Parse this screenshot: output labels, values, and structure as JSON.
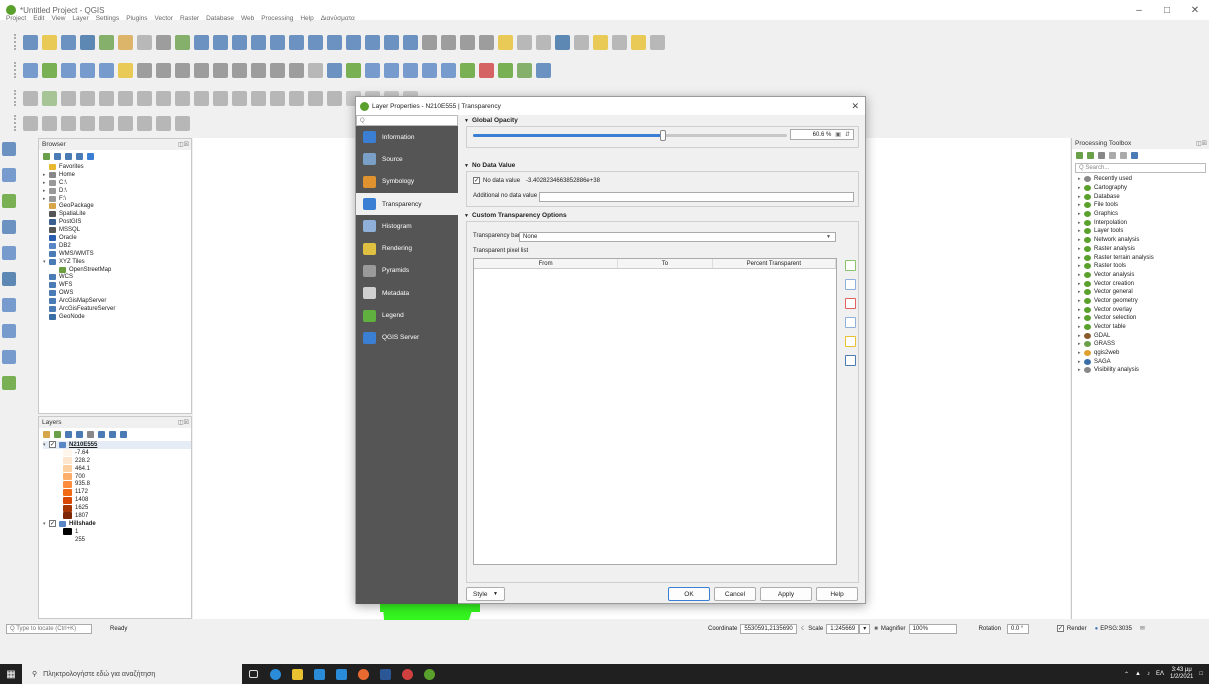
{
  "window": {
    "title": "*Untitled Project - QGIS",
    "min": "–",
    "max": "□",
    "close": "✕"
  },
  "menu": [
    "Project",
    "Edit",
    "View",
    "Layer",
    "Settings",
    "Plugins",
    "Vector",
    "Raster",
    "Database",
    "Web",
    "Processing",
    "Help",
    "Διανύσματα"
  ],
  "browser": {
    "title": "Browser",
    "items": [
      {
        "label": "Favorites",
        "color": "#e8b830",
        "arrow": ""
      },
      {
        "label": "Home",
        "color": "#888",
        "arrow": "▸"
      },
      {
        "label": "C:\\",
        "color": "#999",
        "arrow": "▸"
      },
      {
        "label": "D:\\",
        "color": "#999",
        "arrow": "▸"
      },
      {
        "label": "F:\\",
        "color": "#999",
        "arrow": "▸"
      },
      {
        "label": "GeoPackage",
        "color": "#d7a64a",
        "arrow": ""
      },
      {
        "label": "SpatiaLite",
        "color": "#555",
        "arrow": ""
      },
      {
        "label": "PostGIS",
        "color": "#3a5f8f",
        "arrow": ""
      },
      {
        "label": "MSSQL",
        "color": "#555",
        "arrow": ""
      },
      {
        "label": "Oracle",
        "color": "#2a5db0",
        "arrow": ""
      },
      {
        "label": "DB2",
        "color": "#5a86c5",
        "arrow": ""
      },
      {
        "label": "WMS/WMTS",
        "color": "#4b7bb5",
        "arrow": ""
      },
      {
        "label": "XYZ Tiles",
        "color": "#4b7bb5",
        "arrow": "▾"
      },
      {
        "label": "OpenStreetMap",
        "color": "#6a9e3f",
        "arrow": "",
        "indent": true
      },
      {
        "label": "WCS",
        "color": "#4b7bb5",
        "arrow": ""
      },
      {
        "label": "WFS",
        "color": "#4b7bb5",
        "arrow": ""
      },
      {
        "label": "OWS",
        "color": "#4b7bb5",
        "arrow": ""
      },
      {
        "label": "ArcGisMapServer",
        "color": "#4b7bb5",
        "arrow": ""
      },
      {
        "label": "ArcGisFeatureServer",
        "color": "#4b7bb5",
        "arrow": ""
      },
      {
        "label": "GeoNode",
        "color": "#3a6ea5",
        "arrow": ""
      }
    ]
  },
  "layers": {
    "title": "Layers",
    "layer1": "N210E555",
    "legend": [
      {
        "label": "-7.64",
        "color": "#fff5eb"
      },
      {
        "label": "228.2",
        "color": "#fee6ce"
      },
      {
        "label": "464.1",
        "color": "#fdd0a2"
      },
      {
        "label": "700",
        "color": "#fdae6b"
      },
      {
        "label": "935.8",
        "color": "#fd8d3c"
      },
      {
        "label": "1172",
        "color": "#f16913"
      },
      {
        "label": "1408",
        "color": "#d94801"
      },
      {
        "label": "1625",
        "color": "#a63603"
      },
      {
        "label": "1807",
        "color": "#7f2704"
      }
    ],
    "layer2": "Hillshade",
    "hs": [
      {
        "label": "1",
        "color": "#000"
      },
      {
        "label": "255",
        "color": "#fff"
      }
    ]
  },
  "dialog": {
    "title": "Layer Properties - N210E555 | Transparency",
    "search_placeholder": "Q",
    "nav": [
      {
        "label": "Information",
        "color": "#3b7fd4"
      },
      {
        "label": "Source",
        "color": "#7aa0c8"
      },
      {
        "label": "Symbology",
        "color": "#e0922f"
      },
      {
        "label": "Transparency",
        "color": "#3b7fd4"
      },
      {
        "label": "Histogram",
        "color": "#8fb0d8"
      },
      {
        "label": "Rendering",
        "color": "#e0c040"
      },
      {
        "label": "Pyramids",
        "color": "#9a9a9a"
      },
      {
        "label": "Metadata",
        "color": "#d0d0d0"
      },
      {
        "label": "Legend",
        "color": "#60b040"
      },
      {
        "label": "QGIS Server",
        "color": "#3b7fd4"
      }
    ],
    "global_opacity": {
      "label": "Global Opacity",
      "value": "60.6 %",
      "fraction": 0.606
    },
    "no_data": {
      "label": "No Data Value",
      "checkbox_label": "No data value",
      "value": "-3.4028234663852886e+38",
      "additional_label": "Additional no data value"
    },
    "custom": {
      "label": "Custom Transparency Options",
      "band_label": "Transparency band",
      "band_value": "None",
      "list_label": "Transparent pixel list",
      "cols": [
        "From",
        "To",
        "Percent Transparent"
      ]
    },
    "buttons": {
      "style": "Style",
      "ok": "OK",
      "cancel": "Cancel",
      "apply": "Apply",
      "help": "Help"
    }
  },
  "processing": {
    "title": "Processing Toolbox",
    "search_placeholder": "Q  Search...",
    "items": [
      {
        "label": "Recently used",
        "color": "#888"
      },
      {
        "label": "Cartography",
        "color": "#5aa02c"
      },
      {
        "label": "Database",
        "color": "#5aa02c"
      },
      {
        "label": "File tools",
        "color": "#5aa02c"
      },
      {
        "label": "Graphics",
        "color": "#5aa02c"
      },
      {
        "label": "Interpolation",
        "color": "#5aa02c"
      },
      {
        "label": "Layer tools",
        "color": "#5aa02c"
      },
      {
        "label": "Network analysis",
        "color": "#5aa02c"
      },
      {
        "label": "Raster analysis",
        "color": "#5aa02c"
      },
      {
        "label": "Raster terrain analysis",
        "color": "#5aa02c"
      },
      {
        "label": "Raster tools",
        "color": "#5aa02c"
      },
      {
        "label": "Vector analysis",
        "color": "#5aa02c"
      },
      {
        "label": "Vector creation",
        "color": "#5aa02c"
      },
      {
        "label": "Vector general",
        "color": "#5aa02c"
      },
      {
        "label": "Vector geometry",
        "color": "#5aa02c"
      },
      {
        "label": "Vector overlay",
        "color": "#5aa02c"
      },
      {
        "label": "Vector selection",
        "color": "#5aa02c"
      },
      {
        "label": "Vector table",
        "color": "#5aa02c"
      },
      {
        "label": "GDAL",
        "color": "#8a5a2a"
      },
      {
        "label": "GRASS",
        "color": "#6aa04a"
      },
      {
        "label": "qgis2web",
        "color": "#e0a030"
      },
      {
        "label": "SAGA",
        "color": "#3a6ea5"
      },
      {
        "label": "Visibility analysis",
        "color": "#888"
      }
    ]
  },
  "statusbar": {
    "locate_placeholder": "Q  Type to locate (Ctrl+K)",
    "ready": "Ready",
    "coordinate_label": "Coordinate",
    "coordinate_value": "5530591,2135690",
    "scale_label": "Scale",
    "scale_value": "1:245669",
    "magnifier_label": "Magnifier",
    "magnifier_value": "100%",
    "rotation_label": "Rotation",
    "rotation_value": "0.0 °",
    "render_label": "Render",
    "crs": "EPSG:3035"
  },
  "taskbar": {
    "search_placeholder": "Πληκτρολογήστε εδώ για αναζήτηση",
    "lang": "ΕΛ",
    "time": "3:43 μμ",
    "date": "1/2/2021"
  }
}
